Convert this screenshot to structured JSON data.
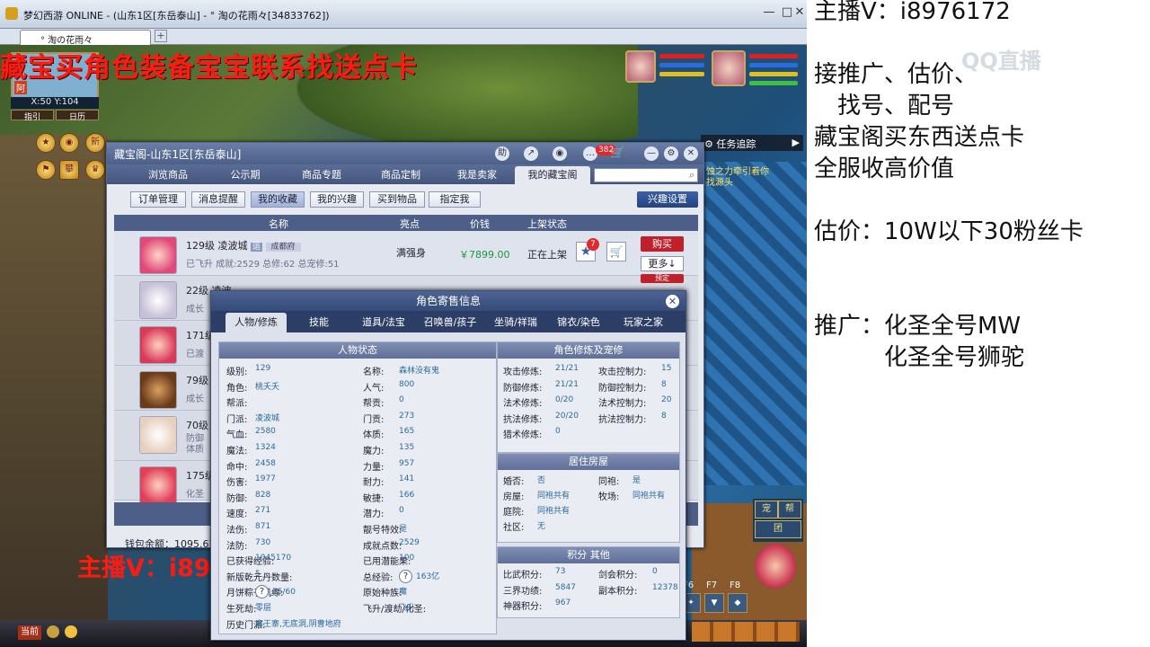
{
  "window": {
    "title": "梦幻西游 ONLINE - (山东1区[东岳泰山] - ° 淘の花雨々[34833762])",
    "tab": "° 淘の花雨々",
    "minimize": "—",
    "maximize": "□",
    "close": "✕",
    "tab_plus": "+"
  },
  "game": {
    "promo": "藏宝买角色装备宝宝联系找送点卡",
    "coords": "X:50 Y:104",
    "map_btns": [
      "指引",
      "日历"
    ],
    "map_char": "阿",
    "top_icons": [
      "新",
      "攀"
    ],
    "task_track": "任务追踪",
    "task_msg": "蚀之力牵引着你",
    "task_msg2": "找源头",
    "right_btns": [
      "宠",
      "帮",
      "团",
      "队"
    ],
    "f_keys": [
      "F6",
      "F7",
      "F8"
    ],
    "bottom_left": "当前",
    "overlay_streamer": "主播V：i8976172",
    "colors": {
      "promo": "#ff1a10",
      "hp": "#e02020",
      "mp": "#2a6be0"
    }
  },
  "cbg": {
    "title": "藏宝阁-山东1区[东岳泰山]",
    "head_icons": [
      "助",
      "↗",
      "◉",
      "…"
    ],
    "badge": "382",
    "win_ctrl": [
      "—",
      "⚙",
      "✕"
    ],
    "tabs": [
      "浏览商品",
      "公示期",
      "商品专题",
      "商品定制",
      "我是卖家",
      "我的藏宝阁"
    ],
    "subtabs": [
      "订单管理",
      "消息提醒",
      "我的收藏",
      "我的兴趣",
      "买到物品",
      "指定我"
    ],
    "interest_btn": "兴趣设置",
    "cols": [
      "名称",
      "亮点",
      "价钱",
      "上架状态"
    ],
    "rows": [
      {
        "level": "129级",
        "name": "凌波城",
        "tag": "运",
        "server": "成都府",
        "sub": "已飞升 成就:2529 总修:62 总宠修:51",
        "highlight": "满强身",
        "price": "￥7899.00",
        "status": "正在上架",
        "fav_count": "7",
        "buy": "购买",
        "more": "更多↓"
      },
      {
        "level": "22级",
        "name": "凌波",
        "sub": "成长",
        "buy": "预定"
      },
      {
        "level": "171级",
        "sub": "已渡"
      },
      {
        "level": "79级",
        "sub": "成长"
      },
      {
        "level": "70级",
        "sub": "防御",
        "sub2": "体质"
      },
      {
        "level": "175级",
        "sub": "化圣"
      }
    ],
    "wallet": "钱包余额：1095.67"
  },
  "info": {
    "title": "角色寄售信息",
    "close": "✕",
    "tabs": [
      "人物/修炼",
      "技能",
      "道具/法宝",
      "召唤兽/孩子",
      "坐骑/祥瑞",
      "锦衣/染色",
      "玩家之家"
    ],
    "status_title": "人物状态",
    "status": [
      [
        "级别:",
        "129",
        "名称:",
        "森林没有鬼"
      ],
      [
        "角色:",
        "桃夭夭",
        "人气:",
        "800"
      ],
      [
        "帮派:",
        "",
        "帮贡:",
        "0"
      ],
      [
        "门派:",
        "凌波城",
        "门贡:",
        "273"
      ],
      [
        "气血:",
        "2580",
        "体质:",
        "165"
      ],
      [
        "魔法:",
        "1324",
        "魔力:",
        "135"
      ],
      [
        "命中:",
        "2458",
        "力量:",
        "957"
      ],
      [
        "伤害:",
        "1977",
        "耐力:",
        "141"
      ],
      [
        "防御:",
        "828",
        "敏捷:",
        "166"
      ],
      [
        "速度:",
        "271",
        "潜力:",
        "0"
      ],
      [
        "法伤:",
        "871",
        "靓号特效:",
        "是"
      ],
      [
        "法防:",
        "730",
        "成就点数:",
        "2529"
      ],
      [
        "已获得经验:",
        "1045170",
        "已用潜能果:",
        "100"
      ],
      [
        "新版乾元丹数量:",
        "5",
        "总经验:",
        "163亿"
      ],
      [
        "月饼粽子机缘:",
        "15/60",
        "原始种族:",
        "魔"
      ],
      [
        "生死劫:",
        "零层",
        "飞升/渡劫/化圣:",
        "飞升"
      ],
      [
        "历史门派:",
        "魔王寨,无底洞,阴曹地府",
        "",
        ""
      ]
    ],
    "cult_title": "角色修炼及宠修",
    "cult": [
      [
        "攻击修炼:",
        "21/21",
        "攻击控制力:",
        "15"
      ],
      [
        "防御修炼:",
        "21/21",
        "防御控制力:",
        "8"
      ],
      [
        "法术修炼:",
        "0/20",
        "法术控制力:",
        "20"
      ],
      [
        "抗法修炼:",
        "20/20",
        "抗法控制力:",
        "8"
      ],
      [
        "猎术修炼:",
        "0",
        "",
        ""
      ]
    ],
    "house_title": "居住房屋",
    "house": [
      [
        "婚否:",
        "否",
        "同袍:",
        "是"
      ],
      [
        "房屋:",
        "同袍共有",
        "牧场:",
        "同袍共有"
      ],
      [
        "庭院:",
        "同袍共有",
        "",
        ""
      ],
      [
        "社区:",
        "无",
        "",
        ""
      ]
    ],
    "score_title": "积分 其他",
    "score": [
      [
        "比武积分:",
        "73",
        "剑会积分:",
        "0"
      ],
      [
        "三界功绩:",
        "5847",
        "副本积分:",
        "12378"
      ],
      [
        "神器积分:",
        "967",
        "",
        ""
      ]
    ]
  },
  "stream": {
    "lines": [
      "主播V：i8976172",
      "",
      "接推广、估价、",
      "　找号、配号",
      "藏宝阁买东西送点卡",
      "全服收高价值",
      "",
      "估价：10W以下30粉丝卡",
      "",
      "",
      "推广：化圣全号MW",
      "　　　化圣全号狮驼"
    ],
    "logo": "QQ直播"
  }
}
